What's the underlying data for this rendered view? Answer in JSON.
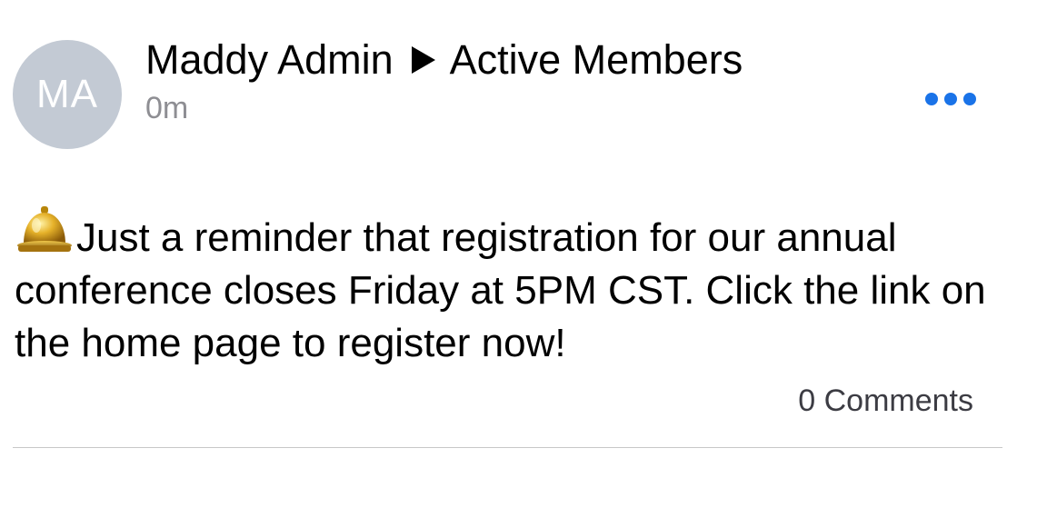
{
  "post": {
    "author_initials": "MA",
    "author_name": "Maddy Admin",
    "group_name": "Active Members",
    "timestamp": "0m",
    "body_text": "Just a reminder that registration for our annual conference closes Friday at 5PM CST. Click the link on the home page to register now!",
    "comments_label": "0 Comments"
  },
  "icons": {
    "bell": "bell-icon",
    "arrow": "triangle-right-icon",
    "more": "more-horizontal-icon"
  },
  "colors": {
    "avatar_bg": "#c3cad4",
    "accent": "#1a73e8",
    "timestamp": "#8e8e93"
  }
}
